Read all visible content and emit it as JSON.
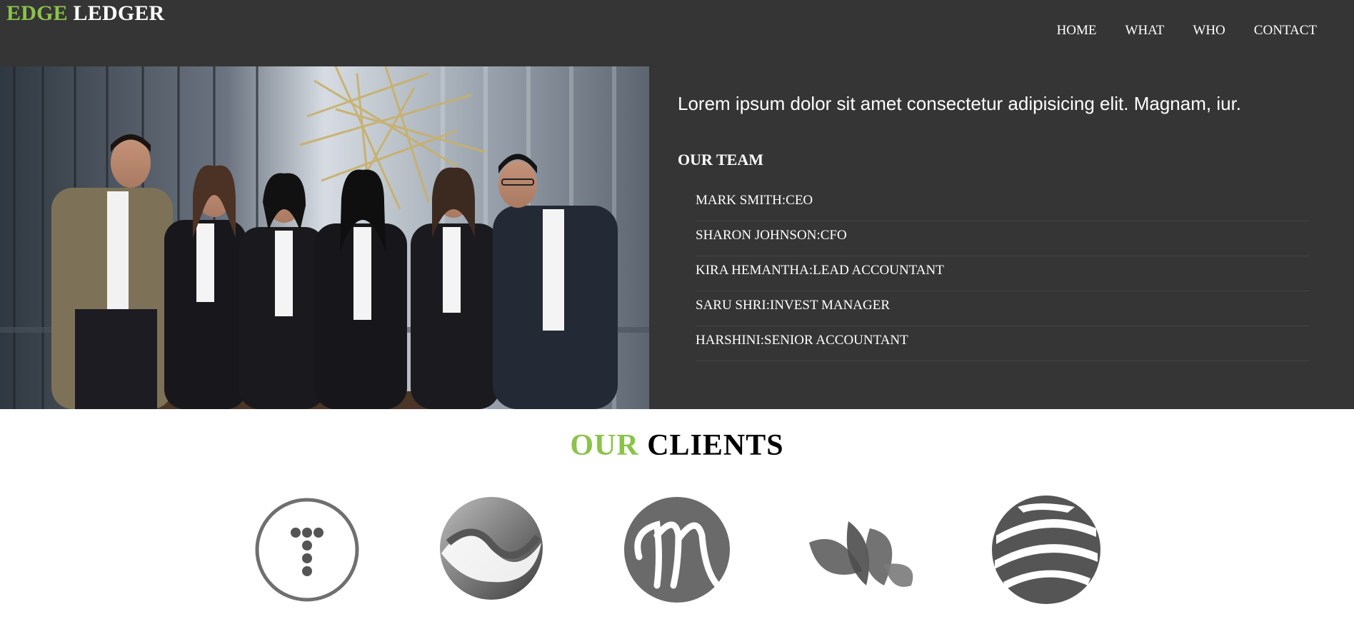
{
  "brand": {
    "part1": "EDGE",
    "part2": "LEDGER",
    "accent_color": "#8bc34a"
  },
  "nav": {
    "items": [
      "HOME",
      "WHAT",
      "WHO",
      "CONTACT"
    ]
  },
  "hero": {
    "lead": "Lorem ipsum dolor sit amet consectetur adipisicing elit. Magnam, iur.",
    "team_title": "OUR TEAM",
    "team": [
      "MARK SMITH:CEO",
      "SHARON JOHNSON:CFO",
      "KIRA HEMANTHA:LEAD ACCOUNTANT",
      "SARU SHRI:INVEST MANAGER",
      "HARSHINI:SENIOR ACCOUNTANT"
    ]
  },
  "clients": {
    "title_part1": "OUR",
    "title_part2": "CLIENTS",
    "logos": [
      "dots-t-logo",
      "swirl-sphere-logo",
      "script-m-logo",
      "leaf-petals-logo",
      "striped-globe-logo"
    ]
  },
  "colors": {
    "header_bg": "#353535",
    "accent": "#8bc34a",
    "text_light": "#ffffff"
  }
}
